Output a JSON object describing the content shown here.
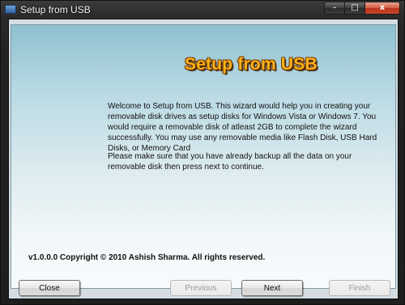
{
  "window": {
    "title": "Setup from USB",
    "controls": {
      "minimize": "–",
      "maximize": "□",
      "close": "x"
    }
  },
  "main": {
    "heading": "Setup from USB",
    "paragraphs": [
      "Welcome to Setup from USB. This wizard would help you in creating your removable disk drives as setup disks for Windows Vista or Windows 7. You would require a removable disk of atleast 2GB to complete the wizard successfully. You may use any removable media like Flash Disk, USB Hard Disks, or Memory Card",
      "Please make sure that you have already backup all the data on your removable disk then press next to continue."
    ],
    "copyright": "v1.0.0.0 Copyright © 2010 Ashish Sharma. All rights reserved."
  },
  "buttons": {
    "close": "Close",
    "previous": "Previous",
    "next": "Next",
    "finish": "Finish"
  },
  "colors": {
    "heading_orange": "#ffb21c",
    "panel_top": "#8ec0cf",
    "panel_bottom": "#f7fbfc",
    "close_button_red": "#c7472b"
  }
}
